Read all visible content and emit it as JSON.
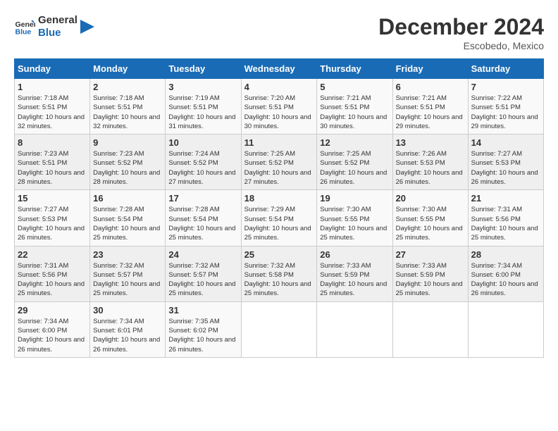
{
  "logo": {
    "line1": "General",
    "line2": "Blue"
  },
  "title": "December 2024",
  "subtitle": "Escobedo, Mexico",
  "days_of_week": [
    "Sunday",
    "Monday",
    "Tuesday",
    "Wednesday",
    "Thursday",
    "Friday",
    "Saturday"
  ],
  "weeks": [
    [
      {
        "day": "1",
        "sunrise": "7:18 AM",
        "sunset": "5:51 PM",
        "daylight": "10 hours and 32 minutes."
      },
      {
        "day": "2",
        "sunrise": "7:18 AM",
        "sunset": "5:51 PM",
        "daylight": "10 hours and 32 minutes."
      },
      {
        "day": "3",
        "sunrise": "7:19 AM",
        "sunset": "5:51 PM",
        "daylight": "10 hours and 31 minutes."
      },
      {
        "day": "4",
        "sunrise": "7:20 AM",
        "sunset": "5:51 PM",
        "daylight": "10 hours and 30 minutes."
      },
      {
        "day": "5",
        "sunrise": "7:21 AM",
        "sunset": "5:51 PM",
        "daylight": "10 hours and 30 minutes."
      },
      {
        "day": "6",
        "sunrise": "7:21 AM",
        "sunset": "5:51 PM",
        "daylight": "10 hours and 29 minutes."
      },
      {
        "day": "7",
        "sunrise": "7:22 AM",
        "sunset": "5:51 PM",
        "daylight": "10 hours and 29 minutes."
      }
    ],
    [
      {
        "day": "8",
        "sunrise": "7:23 AM",
        "sunset": "5:51 PM",
        "daylight": "10 hours and 28 minutes."
      },
      {
        "day": "9",
        "sunrise": "7:23 AM",
        "sunset": "5:52 PM",
        "daylight": "10 hours and 28 minutes."
      },
      {
        "day": "10",
        "sunrise": "7:24 AM",
        "sunset": "5:52 PM",
        "daylight": "10 hours and 27 minutes."
      },
      {
        "day": "11",
        "sunrise": "7:25 AM",
        "sunset": "5:52 PM",
        "daylight": "10 hours and 27 minutes."
      },
      {
        "day": "12",
        "sunrise": "7:25 AM",
        "sunset": "5:52 PM",
        "daylight": "10 hours and 26 minutes."
      },
      {
        "day": "13",
        "sunrise": "7:26 AM",
        "sunset": "5:53 PM",
        "daylight": "10 hours and 26 minutes."
      },
      {
        "day": "14",
        "sunrise": "7:27 AM",
        "sunset": "5:53 PM",
        "daylight": "10 hours and 26 minutes."
      }
    ],
    [
      {
        "day": "15",
        "sunrise": "7:27 AM",
        "sunset": "5:53 PM",
        "daylight": "10 hours and 26 minutes."
      },
      {
        "day": "16",
        "sunrise": "7:28 AM",
        "sunset": "5:54 PM",
        "daylight": "10 hours and 25 minutes."
      },
      {
        "day": "17",
        "sunrise": "7:28 AM",
        "sunset": "5:54 PM",
        "daylight": "10 hours and 25 minutes."
      },
      {
        "day": "18",
        "sunrise": "7:29 AM",
        "sunset": "5:54 PM",
        "daylight": "10 hours and 25 minutes."
      },
      {
        "day": "19",
        "sunrise": "7:30 AM",
        "sunset": "5:55 PM",
        "daylight": "10 hours and 25 minutes."
      },
      {
        "day": "20",
        "sunrise": "7:30 AM",
        "sunset": "5:55 PM",
        "daylight": "10 hours and 25 minutes."
      },
      {
        "day": "21",
        "sunrise": "7:31 AM",
        "sunset": "5:56 PM",
        "daylight": "10 hours and 25 minutes."
      }
    ],
    [
      {
        "day": "22",
        "sunrise": "7:31 AM",
        "sunset": "5:56 PM",
        "daylight": "10 hours and 25 minutes."
      },
      {
        "day": "23",
        "sunrise": "7:32 AM",
        "sunset": "5:57 PM",
        "daylight": "10 hours and 25 minutes."
      },
      {
        "day": "24",
        "sunrise": "7:32 AM",
        "sunset": "5:57 PM",
        "daylight": "10 hours and 25 minutes."
      },
      {
        "day": "25",
        "sunrise": "7:32 AM",
        "sunset": "5:58 PM",
        "daylight": "10 hours and 25 minutes."
      },
      {
        "day": "26",
        "sunrise": "7:33 AM",
        "sunset": "5:59 PM",
        "daylight": "10 hours and 25 minutes."
      },
      {
        "day": "27",
        "sunrise": "7:33 AM",
        "sunset": "5:59 PM",
        "daylight": "10 hours and 25 minutes."
      },
      {
        "day": "28",
        "sunrise": "7:34 AM",
        "sunset": "6:00 PM",
        "daylight": "10 hours and 26 minutes."
      }
    ],
    [
      {
        "day": "29",
        "sunrise": "7:34 AM",
        "sunset": "6:00 PM",
        "daylight": "10 hours and 26 minutes."
      },
      {
        "day": "30",
        "sunrise": "7:34 AM",
        "sunset": "6:01 PM",
        "daylight": "10 hours and 26 minutes."
      },
      {
        "day": "31",
        "sunrise": "7:35 AM",
        "sunset": "6:02 PM",
        "daylight": "10 hours and 26 minutes."
      },
      null,
      null,
      null,
      null
    ]
  ]
}
